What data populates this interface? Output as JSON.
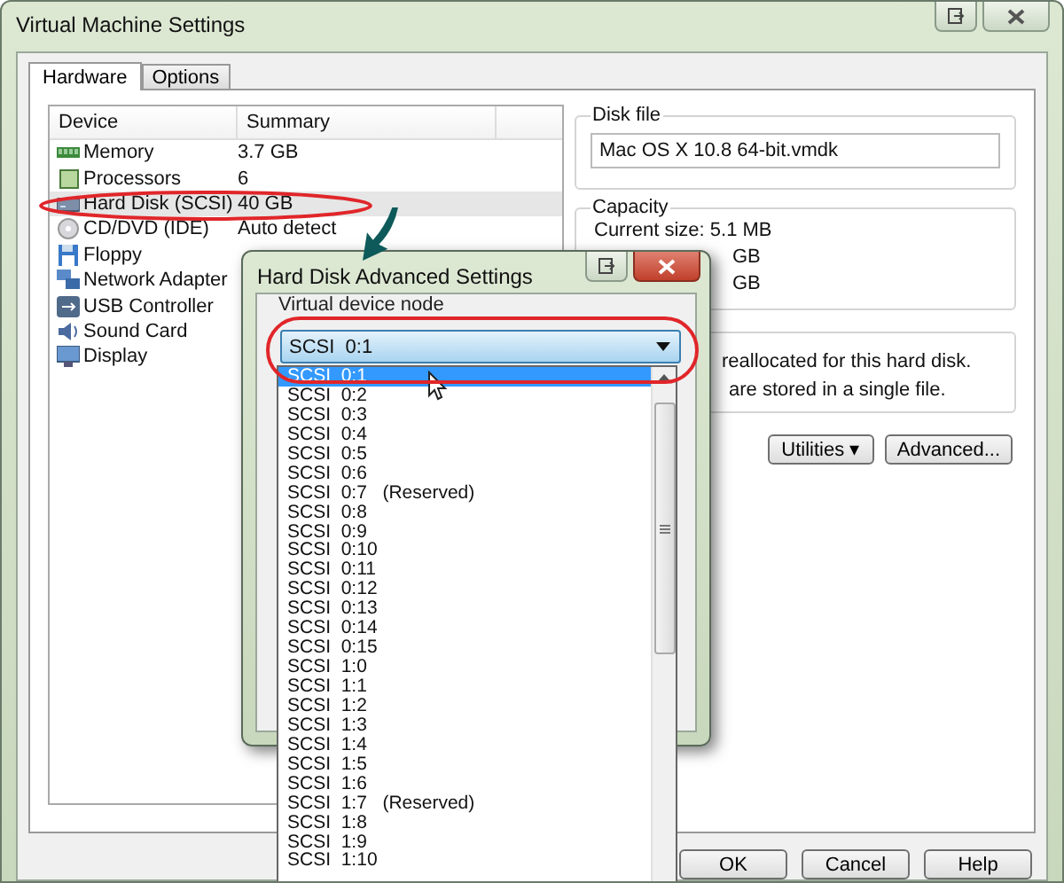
{
  "window": {
    "title": "Virtual Machine Settings"
  },
  "tabs": [
    {
      "label": "Hardware",
      "selected": true
    },
    {
      "label": "Options",
      "selected": false
    }
  ],
  "devices": {
    "columns": [
      "Device",
      "Summary"
    ],
    "rows": [
      {
        "kind": "memory",
        "name": "Memory",
        "summary": "3.7 GB",
        "selected": false
      },
      {
        "kind": "processor",
        "name": "Processors",
        "summary": "6",
        "selected": false
      },
      {
        "kind": "disk",
        "name": "Hard Disk (SCSI)",
        "summary": "40 GB",
        "selected": true
      },
      {
        "kind": "cdrom",
        "name": "CD/DVD (IDE)",
        "summary": "Auto detect",
        "selected": false
      },
      {
        "kind": "floppy",
        "name": "Floppy",
        "selected": false
      },
      {
        "kind": "network",
        "name": "Network Adapter",
        "selected": false
      },
      {
        "kind": "usb",
        "name": "USB Controller",
        "selected": false
      },
      {
        "kind": "sound",
        "name": "Sound Card",
        "selected": false
      },
      {
        "kind": "display",
        "name": "Display",
        "selected": false
      }
    ]
  },
  "disk_file": {
    "label": "Disk file",
    "value": "Mac OS X 10.8 64-bit.vmdk"
  },
  "capacity": {
    "label": "Capacity",
    "lines": [
      "Current size:  5.1 MB",
      "GB",
      "GB"
    ]
  },
  "allocation": {
    "lines": [
      "reallocated for this hard disk.",
      "are stored in a single file."
    ]
  },
  "side_buttons": [
    "Utilities ▾",
    "Advanced..."
  ],
  "footer_buttons": [
    "OK",
    "Cancel",
    "Help"
  ],
  "dialog": {
    "title": "Hard Disk Advanced Settings",
    "group_label": "Virtual device node",
    "value": "SCSI  0:1",
    "options": [
      {
        "label": "SCSI  0:1",
        "selected": true
      },
      {
        "label": "SCSI  0:2",
        "selected": false
      },
      {
        "label": "SCSI  0:3",
        "selected": false
      },
      {
        "label": "SCSI  0:4",
        "selected": false
      },
      {
        "label": "SCSI  0:5",
        "selected": false
      },
      {
        "label": "SCSI  0:6",
        "selected": false
      },
      {
        "label": "SCSI  0:7",
        "note": "(Reserved)",
        "selected": false
      },
      {
        "label": "SCSI  0:8",
        "selected": false
      },
      {
        "label": "SCSI  0:9",
        "selected": false
      },
      {
        "label": "SCSI  0:10",
        "selected": false
      },
      {
        "label": "SCSI  0:11",
        "selected": false
      },
      {
        "label": "SCSI  0:12",
        "selected": false
      },
      {
        "label": "SCSI  0:13",
        "selected": false
      },
      {
        "label": "SCSI  0:14",
        "selected": false
      },
      {
        "label": "SCSI  0:15",
        "selected": false
      },
      {
        "label": "SCSI  1:0",
        "selected": false
      },
      {
        "label": "SCSI  1:1",
        "selected": false
      },
      {
        "label": "SCSI  1:2",
        "selected": false
      },
      {
        "label": "SCSI  1:3",
        "selected": false
      },
      {
        "label": "SCSI  1:4",
        "selected": false
      },
      {
        "label": "SCSI  1:5",
        "selected": false
      },
      {
        "label": "SCSI  1:6",
        "selected": false
      },
      {
        "label": "SCSI  1:7",
        "note": "(Reserved)",
        "selected": false
      },
      {
        "label": "SCSI  1:8",
        "selected": false
      },
      {
        "label": "SCSI  1:9",
        "selected": false
      },
      {
        "label": "SCSI  1:10",
        "selected": false
      }
    ]
  }
}
